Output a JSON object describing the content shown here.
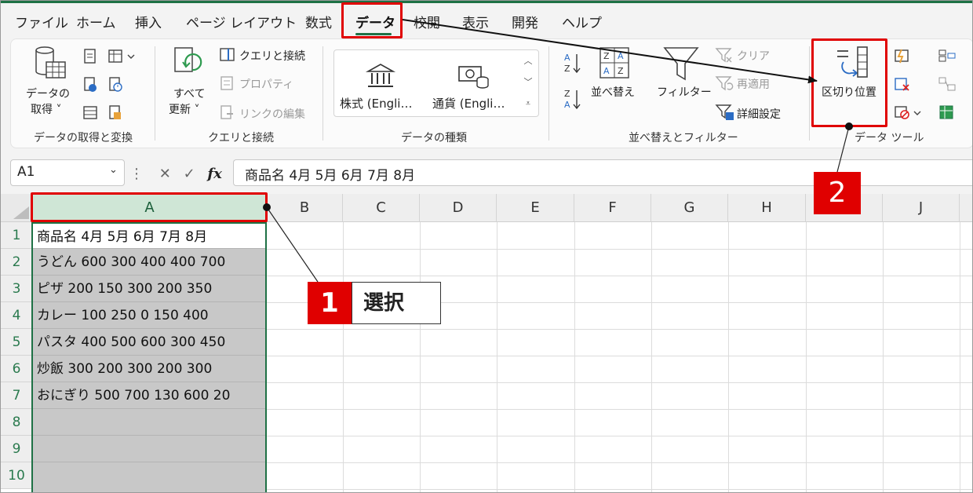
{
  "menu": {
    "tabs": [
      "ファイル",
      "ホーム",
      "挿入",
      "ページ レイアウト",
      "数式",
      "データ",
      "校閲",
      "表示",
      "開発",
      "ヘルプ"
    ],
    "active_tab": "データ"
  },
  "ribbon": {
    "get_data": {
      "label_line1": "データの",
      "label_line2": "取得 ˅",
      "group": "データの取得と変換"
    },
    "refresh_all": {
      "label_line1": "すべて",
      "label_line2": "更新 ˅"
    },
    "queries": {
      "queries_connections": "クエリと接続",
      "properties": "プロパティ",
      "edit_links": "リンクの編集",
      "group": "クエリと接続"
    },
    "data_types": {
      "stocks": "株式 (Engli…",
      "currencies": "通貨 (Engli…",
      "group": "データの種類"
    },
    "sort_filter": {
      "sort": "並べ替え",
      "filter": "フィルター",
      "clear": "クリア",
      "reapply": "再適用",
      "advanced": "詳細設定",
      "group": "並べ替えとフィルター"
    },
    "data_tools": {
      "text_to_columns": "区切り位置",
      "group": "データ ツール"
    }
  },
  "formula_bar": {
    "name_box": "A1",
    "fx": "fx",
    "formula": "商品名 4月 5月 6月 7月 8月"
  },
  "sheet": {
    "columns": [
      "A",
      "B",
      "C",
      "D",
      "E",
      "F",
      "G",
      "H",
      "I",
      "J"
    ],
    "rows": [
      "1",
      "2",
      "3",
      "4",
      "5",
      "6",
      "7",
      "8",
      "9",
      "10"
    ],
    "colA": [
      "商品名 4月 5月 6月 7月 8月",
      "うどん 600 300 400 400 700",
      "ピザ 200 150 300 200 350",
      "カレー 100 250 0 150 400",
      "パスタ 400 500 600 300 450",
      "炒飯 300 200 300 200 300",
      "おにぎり 500 700 130 600 20",
      "",
      "",
      ""
    ]
  },
  "annotations": {
    "step1_number": "1",
    "step1_text": "選択",
    "step2_number": "2"
  },
  "colors": {
    "accent": "#1e7145",
    "highlight": "#e00000",
    "selection": "#c8c8c8"
  }
}
